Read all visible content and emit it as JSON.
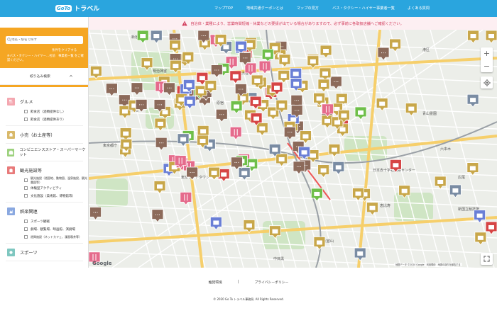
{
  "header": {
    "logo_badge": "GoTo",
    "logo_text": "トラベル",
    "nav": [
      {
        "label": "マップTOP"
      },
      {
        "label": "地域共通クーポンとは"
      },
      {
        "label": "マップの見方"
      },
      {
        "label": "バス・タクシー・ハイヤー事業者一覧"
      },
      {
        "label": "よくある質問"
      }
    ]
  },
  "notice": {
    "text": "自治体・業種により、営業時間短縮・休業などの要請が出ている場合がありますので、必ず事前に各取扱店舗へご確認ください。"
  },
  "sidebar": {
    "search_placeholder": "地名・駅名で探す",
    "clear_label": "条件をクリアする",
    "note": "※バス・タクシー・ハイヤー…名前　事業者一覧 をご確認ください。",
    "filter_label": "絞り込み検索",
    "categories": [
      {
        "title": "グルメ",
        "color": "#f4a7b0",
        "subs": [
          "飲食店（酒類提供なし）",
          "飲食店（酒類提供あり）"
        ]
      },
      {
        "title": "小売（お土産等）",
        "color": "#d9b96a",
        "subs": []
      },
      {
        "title": "コンビニエンスストア・スーパーマーケット",
        "color": "#9cd17d",
        "subs": []
      },
      {
        "title": "観光施設等",
        "color": "#e87a7a",
        "subs": [
          "観光施設（遊園地、動物園、温泉施設、観光農園等）",
          "体験型アクティビティ",
          "文化施設（美術館、博物館等）"
        ]
      },
      {
        "title": "娯楽関連",
        "color": "#8aa8e0",
        "subs": [
          "スポーツ観戦",
          "劇場、観覧場、映画館、演劇場",
          "遊興施設（ネットカフェ、漫画喫茶等）"
        ]
      },
      {
        "title": "スポーツ",
        "color": "#7fc7c0",
        "subs": []
      }
    ]
  },
  "map": {
    "labels": [
      {
        "text": "渋谷区"
      },
      {
        "text": "新宿区"
      },
      {
        "text": "港区"
      },
      {
        "text": "代々木公園"
      },
      {
        "text": "東京都庁"
      },
      {
        "text": "六本木"
      },
      {
        "text": "恵比寿"
      },
      {
        "text": "原宿"
      },
      {
        "text": "広尾"
      },
      {
        "text": "中目黒"
      },
      {
        "text": "代官山"
      },
      {
        "text": "青山霊園"
      },
      {
        "text": "明治神宮"
      },
      {
        "text": "東京ミッドタウン"
      },
      {
        "text": "新国立競技場"
      },
      {
        "text": "日本赤十字社医療センター"
      }
    ],
    "zoom_in": "+",
    "zoom_out": "−",
    "google_label": "Google",
    "attribution": "地図データ ©2020 Google　利用規約　地図の誤りを報告する",
    "pin_colors": {
      "retail": "#c8a74a",
      "food": "#e56b8c",
      "amusement": "#8c6a5a",
      "convenience": "#6fbf4a",
      "tourism": "#d64545",
      "transport": "#7a8ca3",
      "leisure": "#6a7fd6"
    }
  },
  "footer": {
    "links": [
      "推奨環境",
      "|",
      "プライバシーポリシー"
    ],
    "copyright": "© 2020 Go To トラベル事務局. All Rights Reserved."
  }
}
